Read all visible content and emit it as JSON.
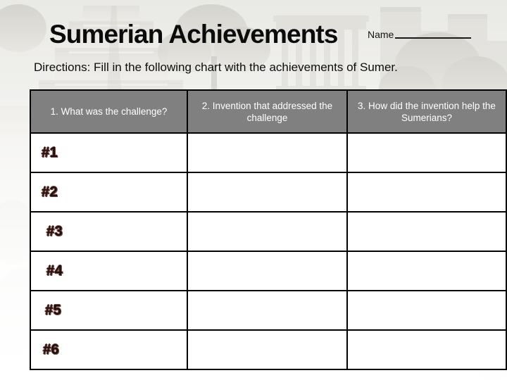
{
  "page": {
    "title": "Sumerian Achievements",
    "directions": "Directions:  Fill in the following chart with the achievements of Sumer.",
    "name_label": "Name",
    "name_value": ""
  },
  "theme": {
    "header_fill": "#808080",
    "header_text": "#ffffff",
    "border": "#000000",
    "cell_fill": "#ffffff",
    "title_text": "#0b0b0b",
    "row_label_text": "#1c1010",
    "row_label_outline": "#7a4a42",
    "background_tint": "#f2f1ec"
  },
  "table": {
    "columns": [
      {
        "key": "challenge",
        "label": "1.  What was the challenge?"
      },
      {
        "key": "invention",
        "label": "2.  Invention that addressed the challenge"
      },
      {
        "key": "help",
        "label": "3.  How did the invention help the Sumerians?"
      }
    ],
    "rows": [
      {
        "label": "#1",
        "challenge": "",
        "invention": "",
        "help": ""
      },
      {
        "label": "#2",
        "challenge": "",
        "invention": "",
        "help": ""
      },
      {
        "label": "#3",
        "challenge": "",
        "invention": "",
        "help": ""
      },
      {
        "label": "#4",
        "challenge": "",
        "invention": "",
        "help": ""
      },
      {
        "label": "#5",
        "challenge": "",
        "invention": "",
        "help": ""
      },
      {
        "label": "#6",
        "challenge": "",
        "invention": "",
        "help": ""
      }
    ]
  }
}
